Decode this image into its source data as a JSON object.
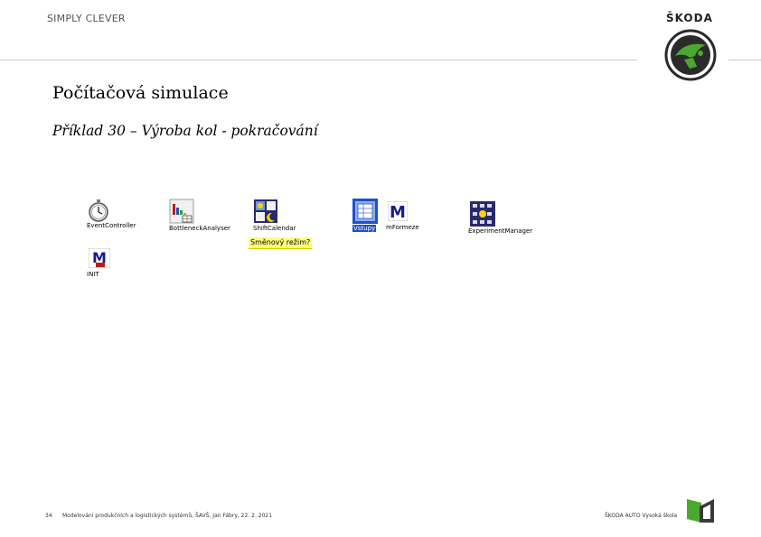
{
  "header": {
    "tagline": "SIMPLY CLEVER",
    "brand": "ŠKODA"
  },
  "slide": {
    "title": "Počítačová simulace",
    "subtitle": "Příklad 30 – Výroba kol - pokračování"
  },
  "objects": [
    {
      "label": "EventController",
      "icon": "stopwatch-icon"
    },
    {
      "label": "BottleneckAnalyser",
      "icon": "bottleneck-analyzer-icon"
    },
    {
      "label": "ShiftCalendar",
      "icon": "shift-calendar-icon"
    },
    {
      "label": "Vstupy",
      "icon": "table-file-icon"
    },
    {
      "label": "mFormeze",
      "icon": "method-icon"
    },
    {
      "label": "ExperimentManager",
      "icon": "experiment-manager-icon"
    },
    {
      "label": "INIT",
      "icon": "init-method-icon"
    }
  ],
  "comment": "Směnový režim?",
  "footer": {
    "page_number": "34",
    "text": "Modelování produkčních a logistických systémů, ŠAVŠ, Jan Fábry, 22. 2. 2021",
    "school": "ŠKODA AUTO Vysoká škola"
  },
  "colors": {
    "brand_green": "#4ba82e",
    "comment_yellow": "#ffff80",
    "method_blue": "#1a1a8c"
  }
}
